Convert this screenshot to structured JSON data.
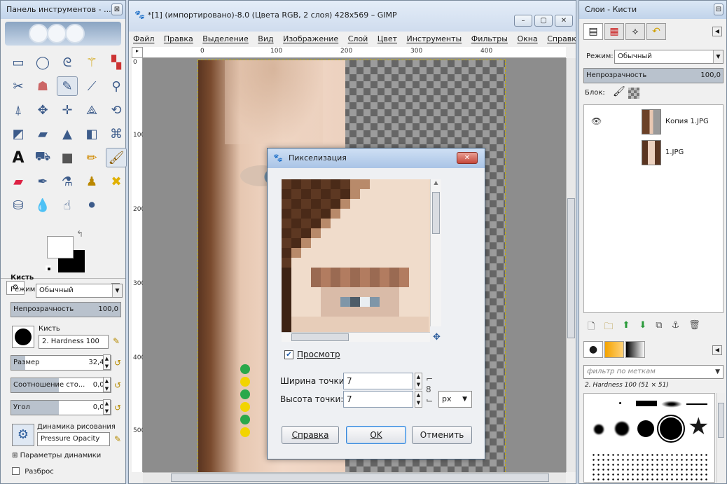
{
  "toolbox": {
    "title": "Панель инструментов - ...",
    "tool_options_title": "Кисть",
    "mode_label": "Режим:",
    "mode_value": "Обычный",
    "opacity_label": "Непрозрачность",
    "opacity_value": "100,0",
    "brush_label": "Кисть",
    "brush_value": "2. Hardness 100",
    "size_label": "Размер",
    "size_value": "32,46",
    "ratio_label": "Соотношение сто...",
    "ratio_value": "0,00",
    "angle_label": "Угол",
    "angle_value": "0,00",
    "dynamics_label": "Динамика рисования",
    "dynamics_value": "Pressure Opacity",
    "dynamics_options": "Параметры динамики",
    "scatter_label": "Разброс"
  },
  "main": {
    "title": "*[1] (импортировано)-8.0 (Цвета RGB, 2 слоя) 428x569 – GIMP",
    "menu": [
      "Файл",
      "Правка",
      "Выделение",
      "Вид",
      "Изображение",
      "Слой",
      "Цвет",
      "Инструменты",
      "Фильтры",
      "Окна",
      "Справка"
    ],
    "hruler_ticks": [
      "0",
      "100",
      "200",
      "300",
      "400"
    ],
    "vruler_ticks": [
      "0",
      "100",
      "200",
      "300",
      "400",
      "500"
    ]
  },
  "dialog": {
    "title": "Пикселизация",
    "preview_label": "Просмотр",
    "preview_checked": true,
    "width_label": "Ширина точки:",
    "width_value": "7",
    "height_label": "Высота точки:",
    "height_value": "7",
    "unit": "px",
    "help_button": "Справка",
    "ok_button": "OK",
    "cancel_button": "Отменить"
  },
  "layers_panel": {
    "title": "Слои - Кисти",
    "mode_label": "Режим:",
    "mode_value": "Обычный",
    "opacity_label": "Непрозрачность",
    "opacity_value": "100,0",
    "lock_label": "Блок:",
    "layers": [
      {
        "name": "Копия 1.JPG",
        "visible": true
      },
      {
        "name": "1.JPG",
        "visible": false
      }
    ],
    "brush_filter_placeholder": "фильтр по меткам",
    "brush_selected": "2. Hardness 100 (51 × 51)"
  },
  "colors": {
    "title_gradient_top": "#dbe7f5",
    "dialog_border": "#45627f",
    "ok_highlight": "#3a86d6"
  }
}
